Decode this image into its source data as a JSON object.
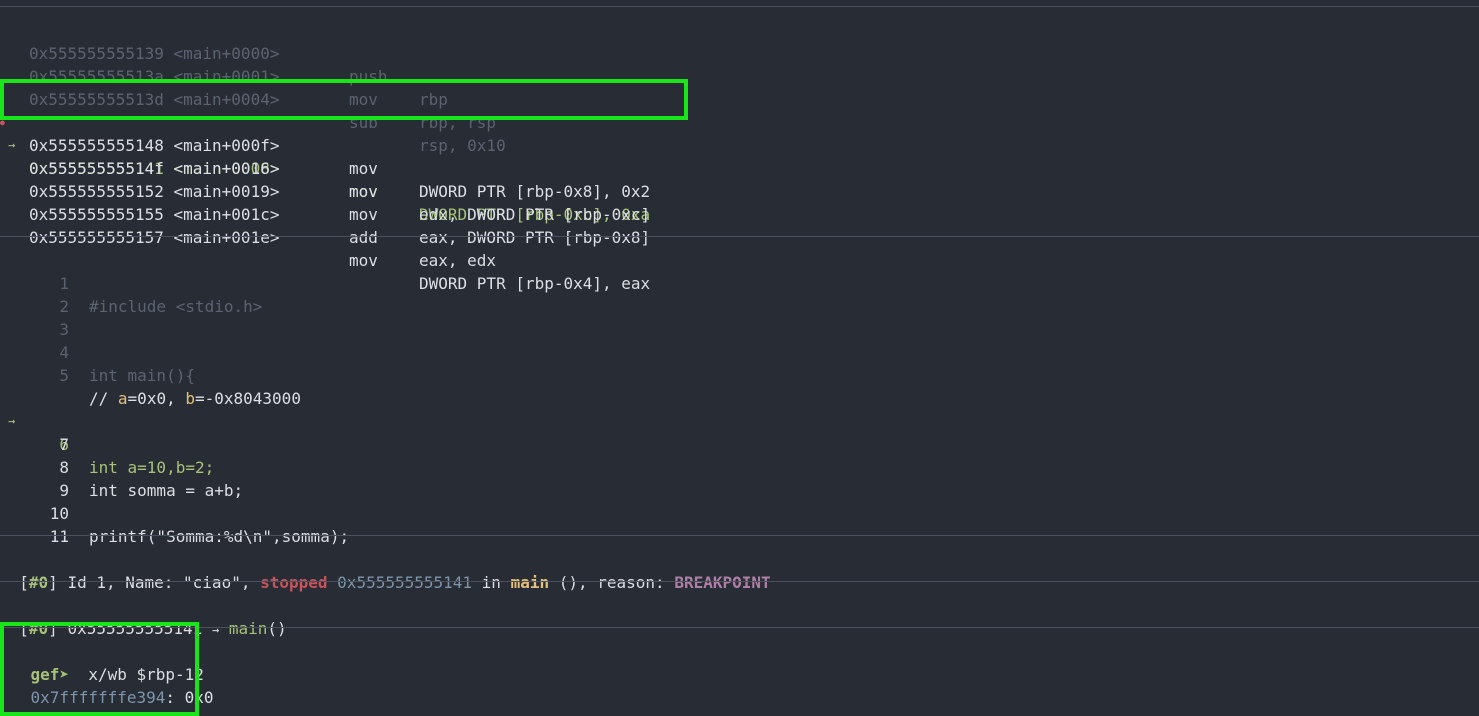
{
  "disasm": [
    {
      "addr": "0x555555555139",
      "sym": "<main+0000>",
      "mnem": "push",
      "ops": "rbp",
      "state": "past"
    },
    {
      "addr": "0x55555555513a",
      "sym": "<main+0001>",
      "mnem": "mov",
      "ops": "rbp, rsp",
      "state": "past"
    },
    {
      "addr": "0x55555555513d",
      "sym": "<main+0004>",
      "mnem": "sub",
      "ops": "rsp, 0x10",
      "state": "past"
    },
    {
      "addr": "0x555555555141",
      "sym": "<main+0008>",
      "mnem": "mov",
      "ops": "DWORD PTR [rbp-0xc], 0xa",
      "state": "current"
    },
    {
      "addr": "0x555555555148",
      "sym": "<main+000f>",
      "mnem": "mov",
      "ops": "DWORD PTR [rbp-0x8], 0x2",
      "state": "next"
    },
    {
      "addr": "0x55555555514f",
      "sym": "<main+0016>",
      "mnem": "mov",
      "ops": "edx, DWORD PTR [rbp-0xc]",
      "state": "next"
    },
    {
      "addr": "0x555555555152",
      "sym": "<main+0019>",
      "mnem": "mov",
      "ops": "eax, DWORD PTR [rbp-0x8]",
      "state": "next"
    },
    {
      "addr": "0x555555555155",
      "sym": "<main+001c>",
      "mnem": "add",
      "ops": "eax, edx",
      "state": "next"
    },
    {
      "addr": "0x555555555157",
      "sym": "<main+001e>",
      "mnem": "mov",
      "ops": "DWORD PTR [rbp-0x4], eax",
      "state": "next"
    }
  ],
  "arrow_glyph": "→",
  "source": {
    "l1": {
      "num": "1",
      "text": "#include <stdio.h>"
    },
    "l2": {
      "num": "2"
    },
    "l3": {
      "num": "3"
    },
    "l4": {
      "num": "4",
      "text": "int main(){"
    },
    "l5": {
      "num": "5"
    },
    "comment": {
      "prefix": "// ",
      "a_name": "a",
      "a_val": "=0x0, ",
      "b_name": "b",
      "b_val": "=-0x8043000"
    },
    "l6": {
      "num": "6",
      "text": "int a=10,b=2;"
    },
    "l7": {
      "num": "7"
    },
    "l8": {
      "num": "8",
      "text": "int somma = a+b;"
    },
    "l9": {
      "num": "9"
    },
    "l10": {
      "num": "10",
      "text": "printf(\"Somma:%d\\n\",somma);"
    },
    "l11": {
      "num": "11"
    }
  },
  "threads": {
    "open": "[",
    "id": "#0",
    "mid": "] Id 1, Name: \"ciao\", ",
    "stopped": "stopped",
    "addr": "0x555555555141",
    "in": " in ",
    "func": "main",
    "reason_text": " (), reason: ",
    "reason": "BREAKPOINT"
  },
  "trace": {
    "open": "[",
    "id": "#0",
    "close": "] 0x555555555141 ",
    "arrow": "→",
    "func": "main",
    "parens": "()"
  },
  "console": {
    "prompt": "gef➤",
    "command": "  x/wb $rbp-12",
    "result_addr": "0x7fffffffe394",
    "result_value": ": 0x0"
  }
}
